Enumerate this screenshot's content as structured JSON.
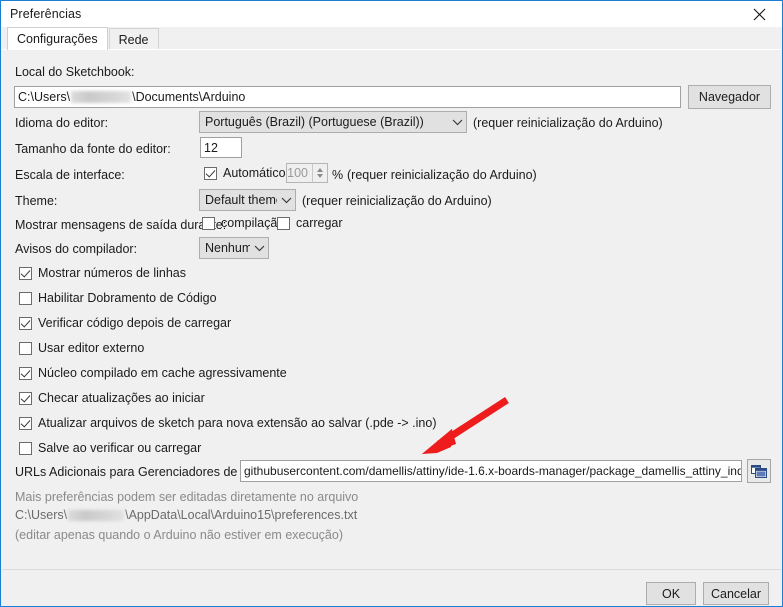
{
  "window": {
    "title": "Preferências",
    "close_icon": "close-icon",
    "border_color": "#1a7fd4"
  },
  "tabs": [
    {
      "label": "Configurações",
      "active": true
    },
    {
      "label": "Rede",
      "active": false
    }
  ],
  "form": {
    "sketchbook": {
      "label": "Local do Sketchbook:",
      "value_prefix": "C:\\Users\\",
      "value_suffix": "\\Documents\\Arduino",
      "redacted": true,
      "browse_button": "Navegador"
    },
    "language": {
      "label": "Idioma do editor:",
      "value": "Português (Brazil) (Portuguese (Brazil))",
      "note": "(requer reinicialização do Arduino)"
    },
    "font_size": {
      "label": "Tamanho da fonte do editor:",
      "value": "12"
    },
    "interface_scale": {
      "label": "Escala de interface:",
      "auto_label": "Automático",
      "auto_checked": true,
      "scale_value": "100",
      "percent": "%",
      "note": "(requer reinicialização do Arduino)"
    },
    "theme": {
      "label": "Theme:",
      "value": "Default theme",
      "note": "(requer reinicialização do Arduino)"
    },
    "verbose": {
      "label": "Mostrar mensagens de saída durante:",
      "options": [
        {
          "label": "compilação",
          "checked": false
        },
        {
          "label": "carregar",
          "checked": false
        }
      ]
    },
    "compiler_warnings": {
      "label": "Avisos do compilador:",
      "value": "Nenhum"
    },
    "checkboxes": [
      {
        "label": "Mostrar números de linhas",
        "checked": true
      },
      {
        "label": "Habilitar Dobramento de Código",
        "checked": false
      },
      {
        "label": "Verificar código depois de carregar",
        "checked": true
      },
      {
        "label": "Usar editor externo",
        "checked": false
      },
      {
        "label": "Núcleo compilado em cache agressivamente",
        "checked": true
      },
      {
        "label": "Checar atualizações ao iniciar",
        "checked": true
      },
      {
        "label": "Atualizar arquivos de sketch para nova extensão ao salvar (.pde -> .ino)",
        "checked": true
      },
      {
        "label": "Salve ao verificar ou carregar",
        "checked": false
      }
    ],
    "additional_urls": {
      "label": "URLs Adicionais para Gerenciadores de Placas:",
      "value": "githubusercontent.com/damellis/attiny/ide-1.6.x-boards-manager/package_damellis_attiny_index.json",
      "expand_icon": "windows-copy-icon"
    }
  },
  "footer_notes": {
    "line1": "Mais preferências podem ser editadas diretamente no arquivo",
    "line2_prefix": "C:\\Users\\",
    "line2_suffix": "\\AppData\\Local\\Arduino15\\preferences.txt",
    "line3": "(editar apenas quando o Arduino não estiver em execução)"
  },
  "buttons": {
    "ok": "OK",
    "cancel": "Cancelar"
  },
  "annotation": {
    "type": "red-arrow",
    "color": "#ee1c1c",
    "points_to": "additional-urls-input"
  }
}
